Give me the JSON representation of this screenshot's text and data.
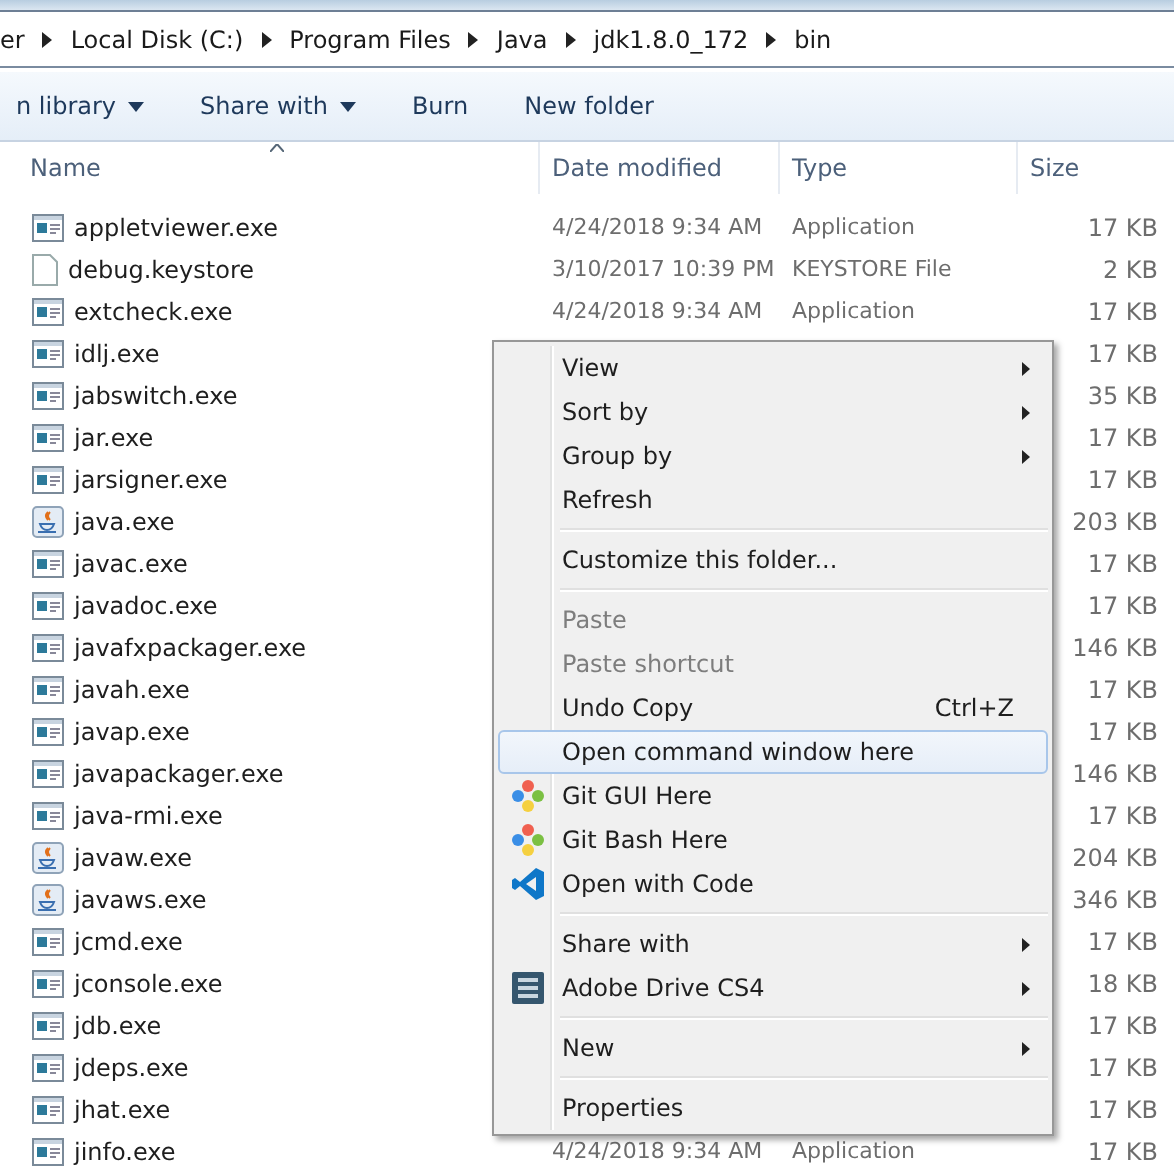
{
  "breadcrumb": [
    "er",
    "Local Disk (C:)",
    "Program Files",
    "Java",
    "jdk1.8.0_172",
    "bin"
  ],
  "toolbar": [
    {
      "label": "n library",
      "dropdown": true
    },
    {
      "label": "Share with",
      "dropdown": true
    },
    {
      "label": "Burn",
      "dropdown": false
    },
    {
      "label": "New folder",
      "dropdown": false
    }
  ],
  "columns": [
    "Name",
    "Date modified",
    "Type",
    "Size"
  ],
  "files": [
    {
      "name": "appletviewer.exe",
      "kind": "exe",
      "date": "4/24/2018 9:34 AM",
      "type": "Application",
      "size": "17 KB"
    },
    {
      "name": "debug.keystore",
      "kind": "file",
      "date": "3/10/2017 10:39 PM",
      "type": "KEYSTORE File",
      "size": "2 KB"
    },
    {
      "name": "extcheck.exe",
      "kind": "exe",
      "date": "4/24/2018 9:34 AM",
      "type": "Application",
      "size": "17 KB"
    },
    {
      "name": "idlj.exe",
      "kind": "exe",
      "size": "17 KB"
    },
    {
      "name": "jabswitch.exe",
      "kind": "exe",
      "size": "35 KB"
    },
    {
      "name": "jar.exe",
      "kind": "exe",
      "size": "17 KB"
    },
    {
      "name": "jarsigner.exe",
      "kind": "exe",
      "size": "17 KB"
    },
    {
      "name": "java.exe",
      "kind": "java",
      "size": "203 KB"
    },
    {
      "name": "javac.exe",
      "kind": "exe",
      "size": "17 KB"
    },
    {
      "name": "javadoc.exe",
      "kind": "exe",
      "size": "17 KB"
    },
    {
      "name": "javafxpackager.exe",
      "kind": "exe",
      "size": "146 KB"
    },
    {
      "name": "javah.exe",
      "kind": "exe",
      "size": "17 KB"
    },
    {
      "name": "javap.exe",
      "kind": "exe",
      "size": "17 KB"
    },
    {
      "name": "javapackager.exe",
      "kind": "exe",
      "size": "146 KB"
    },
    {
      "name": "java-rmi.exe",
      "kind": "exe",
      "size": "17 KB"
    },
    {
      "name": "javaw.exe",
      "kind": "java",
      "size": "204 KB"
    },
    {
      "name": "javaws.exe",
      "kind": "java",
      "size": "346 KB"
    },
    {
      "name": "jcmd.exe",
      "kind": "exe",
      "size": "17 KB"
    },
    {
      "name": "jconsole.exe",
      "kind": "exe",
      "size": "18 KB"
    },
    {
      "name": "jdb.exe",
      "kind": "exe",
      "size": "17 KB"
    },
    {
      "name": "jdeps.exe",
      "kind": "exe",
      "size": "17 KB"
    },
    {
      "name": "jhat.exe",
      "kind": "exe",
      "size": "17 KB"
    },
    {
      "name": "jinfo.exe",
      "kind": "exe",
      "date": "4/24/2018 9:34 AM",
      "type": "Application",
      "size": "17 KB"
    }
  ],
  "context_menu": [
    {
      "kind": "item",
      "label": "View",
      "submenu": true,
      "disabled": false,
      "selected": false
    },
    {
      "kind": "item",
      "label": "Sort by",
      "submenu": true,
      "disabled": false,
      "selected": false
    },
    {
      "kind": "item",
      "label": "Group by",
      "submenu": true,
      "disabled": false,
      "selected": false
    },
    {
      "kind": "item",
      "label": "Refresh",
      "submenu": false,
      "disabled": false,
      "selected": false
    },
    {
      "kind": "separator"
    },
    {
      "kind": "item",
      "label": "Customize this folder...",
      "submenu": false,
      "disabled": false,
      "selected": false
    },
    {
      "kind": "separator"
    },
    {
      "kind": "item",
      "label": "Paste",
      "submenu": false,
      "disabled": true,
      "selected": false
    },
    {
      "kind": "item",
      "label": "Paste shortcut",
      "submenu": false,
      "disabled": true,
      "selected": false
    },
    {
      "kind": "item",
      "label": "Undo Copy",
      "shortcut": "Ctrl+Z",
      "submenu": false,
      "disabled": false,
      "selected": false
    },
    {
      "kind": "item",
      "label": "Open command window here",
      "submenu": false,
      "disabled": false,
      "selected": true
    },
    {
      "kind": "git",
      "label": "Git GUI Here",
      "submenu": false,
      "disabled": false,
      "selected": false
    },
    {
      "kind": "git",
      "label": "Git Bash Here",
      "submenu": false,
      "disabled": false,
      "selected": false
    },
    {
      "kind": "code",
      "label": "Open with Code",
      "submenu": false,
      "disabled": false,
      "selected": false
    },
    {
      "kind": "separator"
    },
    {
      "kind": "item",
      "label": "Share with",
      "submenu": true,
      "disabled": false,
      "selected": false
    },
    {
      "kind": "drive",
      "label": "Adobe Drive CS4",
      "submenu": true,
      "disabled": false,
      "selected": false
    },
    {
      "kind": "separator"
    },
    {
      "kind": "item",
      "label": "New",
      "submenu": true,
      "disabled": false,
      "selected": false
    },
    {
      "kind": "separator"
    },
    {
      "kind": "item",
      "label": "Properties",
      "submenu": false,
      "disabled": false,
      "selected": false
    }
  ]
}
